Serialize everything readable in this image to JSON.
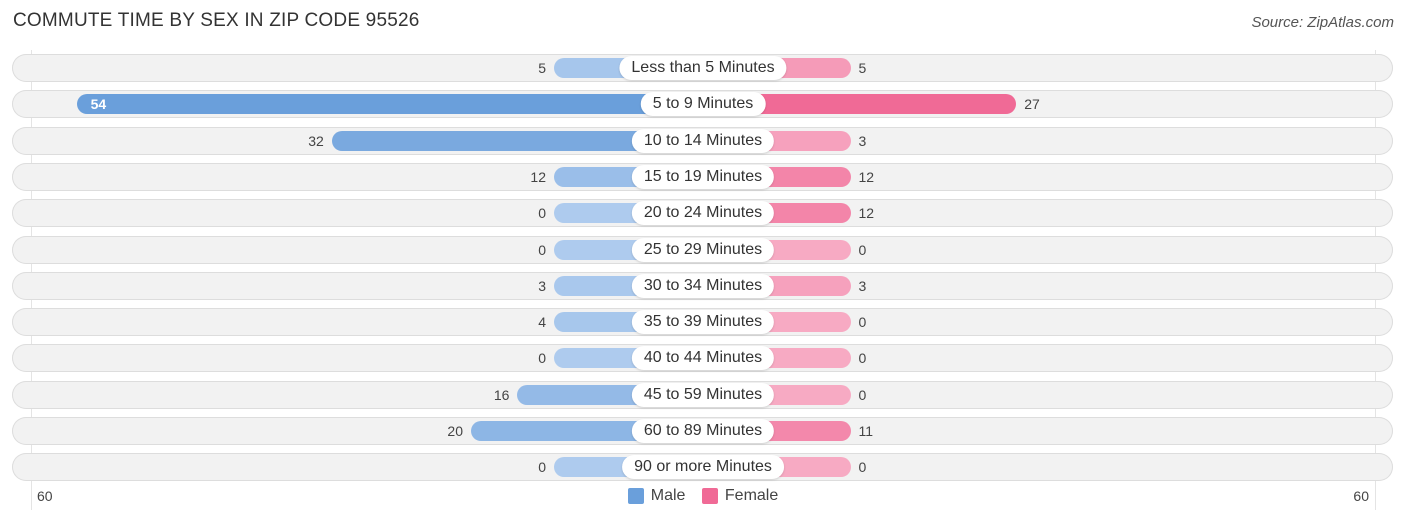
{
  "title": "COMMUTE TIME BY SEX IN ZIP CODE 95526",
  "source": "Source: ZipAtlas.com",
  "chart_data": {
    "type": "bar",
    "orientation": "horizontal-diverging",
    "title": "COMMUTE TIME BY SEX IN ZIP CODE 95526",
    "categories": [
      "Less than 5 Minutes",
      "5 to 9 Minutes",
      "10 to 14 Minutes",
      "15 to 19 Minutes",
      "20 to 24 Minutes",
      "25 to 29 Minutes",
      "30 to 34 Minutes",
      "35 to 39 Minutes",
      "40 to 44 Minutes",
      "45 to 59 Minutes",
      "60 to 89 Minutes",
      "90 or more Minutes"
    ],
    "series": [
      {
        "name": "Male",
        "color": "#6a9fdb",
        "values": [
          5,
          54,
          32,
          12,
          0,
          0,
          3,
          4,
          0,
          16,
          20,
          0
        ]
      },
      {
        "name": "Female",
        "color": "#f06a96",
        "values": [
          5,
          27,
          3,
          12,
          12,
          0,
          3,
          0,
          0,
          0,
          11,
          0
        ]
      }
    ],
    "axis": {
      "left_label": "60",
      "right_label": "60",
      "max": 60
    },
    "legend": {
      "position": "bottom-center",
      "items": [
        "Male",
        "Female"
      ]
    }
  }
}
